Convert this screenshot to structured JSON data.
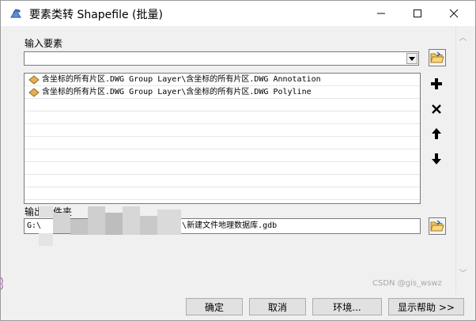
{
  "window": {
    "title": "要素类转 Shapefile (批量)",
    "minimize_glyph": "—",
    "maximize_glyph": "☐",
    "close_glyph": "✕"
  },
  "input_features": {
    "label": "输入要素",
    "combo_value": "",
    "items": [
      {
        "text": "含坐标的所有片区.DWG Group Layer\\含坐标的所有片区.DWG Annotation",
        "icon": "feature-class-icon"
      },
      {
        "text": "含坐标的所有片区.DWG Group Layer\\含坐标的所有片区.DWG Polyline",
        "icon": "feature-class-icon"
      }
    ],
    "side_buttons": [
      "folder-open-icon",
      "add-icon",
      "remove-icon",
      "move-up-icon",
      "move-down-icon"
    ]
  },
  "output_folder": {
    "label": "输出文件夹",
    "value_prefix": "G:\\",
    "value_suffix": "\\新建文件地理数据库.gdb"
  },
  "buttons": {
    "ok": "确定",
    "cancel": "取消",
    "environments": "环境...",
    "show_help": "显示帮助 >>"
  },
  "watermark": "CSDN @gis_wswz",
  "colors": {
    "accent_blue": "#1b5fbf",
    "feature_icon": "#e3b05a",
    "border": "#7a7a7a"
  }
}
